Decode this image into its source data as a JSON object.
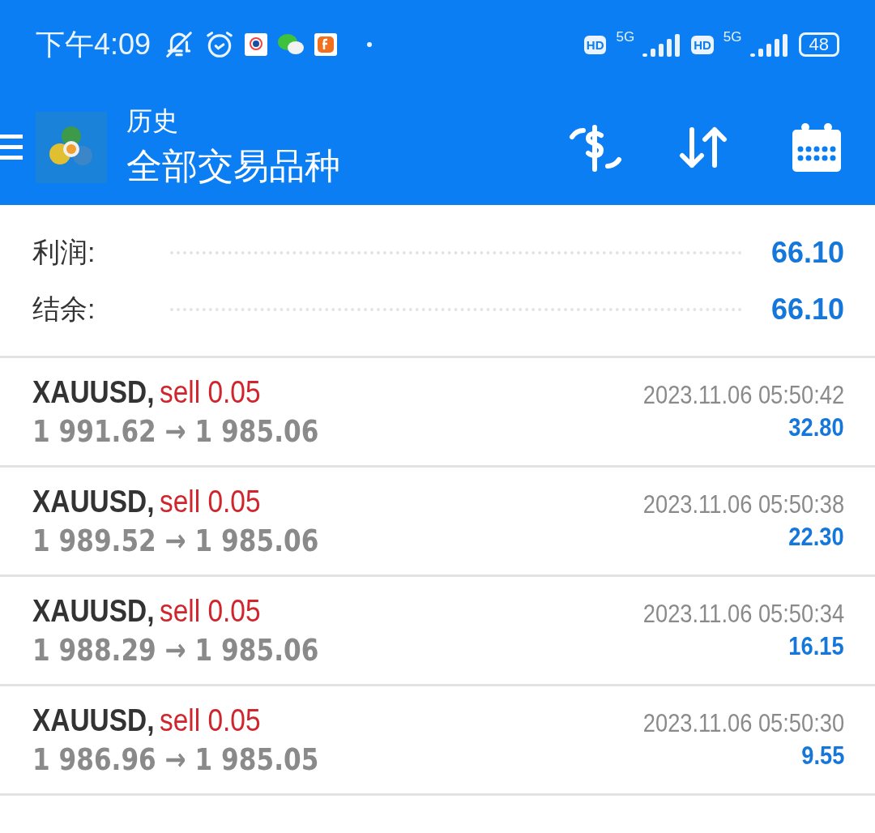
{
  "status_bar": {
    "time": "下午4:09",
    "sim_slots": [
      {
        "hd": "HD",
        "network": "5G"
      },
      {
        "hd": "HD",
        "network": "5G"
      }
    ],
    "battery": "48"
  },
  "header": {
    "title": "历史",
    "subtitle": "全部交易品种"
  },
  "summary": [
    {
      "label": "利润:",
      "value": "66.10"
    },
    {
      "label": "结余:",
      "value": "66.10"
    }
  ],
  "deals": [
    {
      "symbol": "XAUUSD,",
      "kind": "sell",
      "side": "sell 0.05",
      "prices": "1 991.62 → 1 985.06",
      "time": "2023.11.06 05:50:42",
      "profit": "32.80"
    },
    {
      "symbol": "XAUUSD,",
      "kind": "sell",
      "side": "sell 0.05",
      "prices": "1 989.52 → 1 985.06",
      "time": "2023.11.06 05:50:38",
      "profit": "22.30"
    },
    {
      "symbol": "XAUUSD,",
      "kind": "sell",
      "side": "sell 0.05",
      "prices": "1 988.29 → 1 985.06",
      "time": "2023.11.06 05:50:34",
      "profit": "16.15"
    },
    {
      "symbol": "XAUUSD,",
      "kind": "sell",
      "side": "sell 0.05",
      "prices": "1 986.96 → 1 985.05",
      "time": "2023.11.06 05:50:30",
      "profit": "9.55"
    }
  ]
}
